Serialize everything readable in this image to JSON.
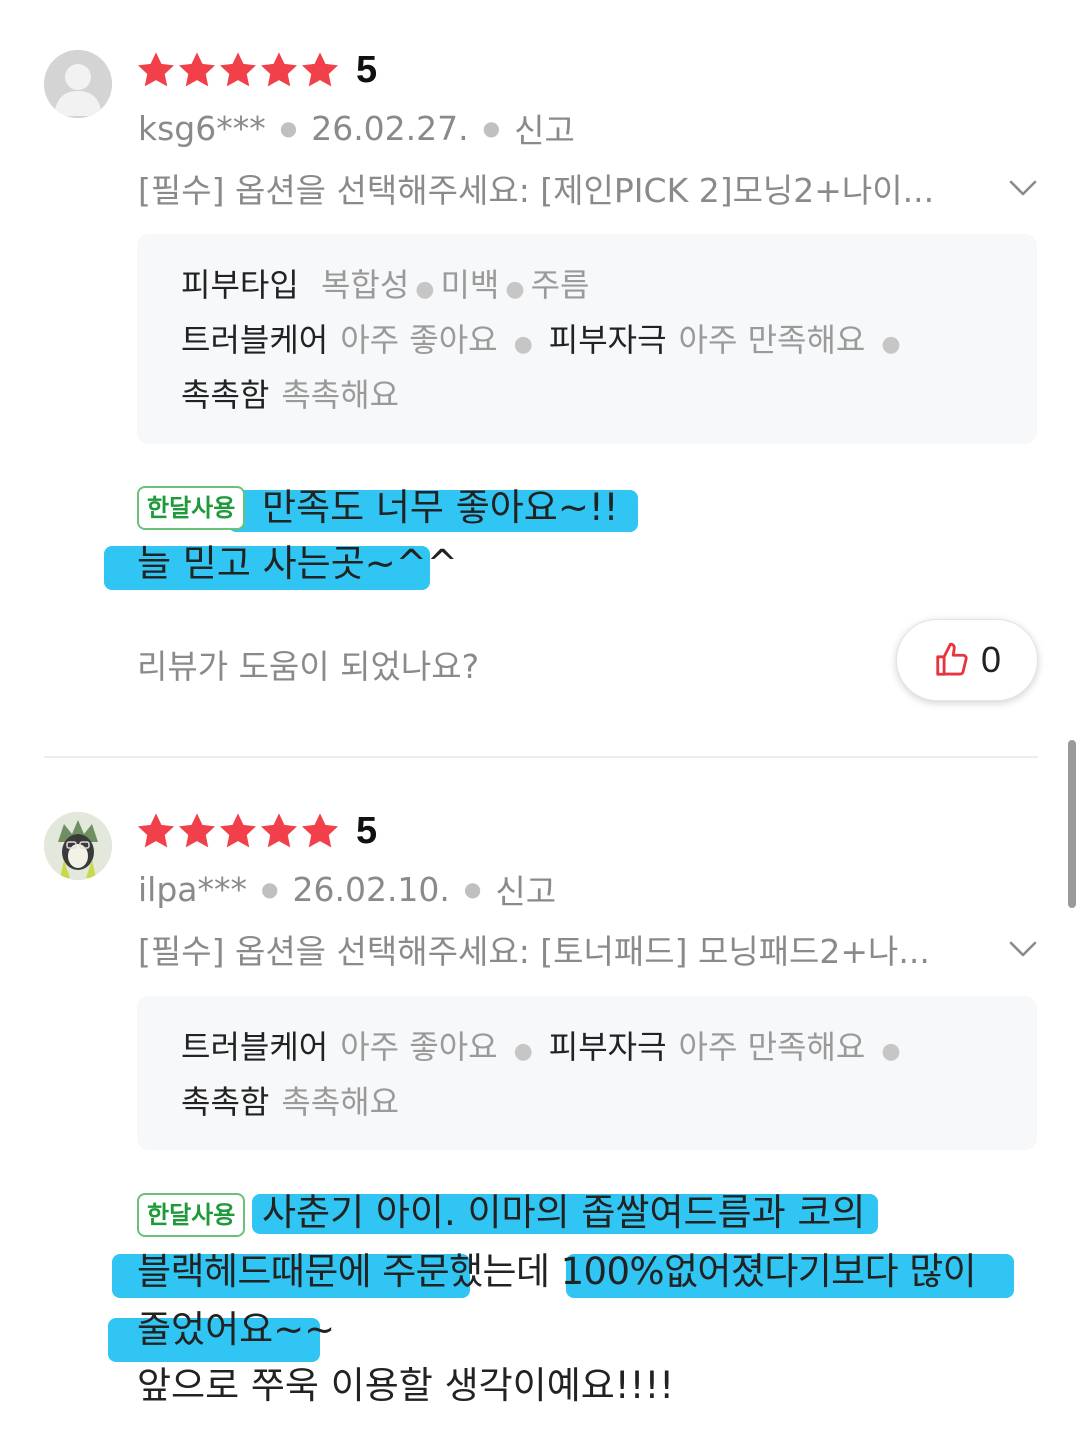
{
  "reviews": [
    {
      "rating": "5",
      "stars": 5,
      "user": "ksg6***",
      "date": "26.02.27.",
      "report": "신고",
      "option": "[필수] 옵션을 선택해주세요: [제인PICK 2]모닝2+나이...",
      "attr_line1": {
        "key": "피부타입",
        "vals": [
          "복합성",
          "미백",
          "주름"
        ]
      },
      "attr_line2": {
        "k1": "트러블케어",
        "v1": "아주 좋아요",
        "k2": "피부자극",
        "v2": "아주 만족해요"
      },
      "attr_line3": {
        "k": "촉촉함",
        "v": "촉촉해요"
      },
      "badge": "한달사용",
      "body": [
        "만족도 너무 좋아요~!!",
        "늘 믿고 사는곳~^^"
      ],
      "helpful_question": "리뷰가 도움이 되었나요?",
      "likes": "0"
    },
    {
      "rating": "5",
      "stars": 5,
      "user": "ilpa***",
      "date": "26.02.10.",
      "report": "신고",
      "option": "[필수] 옵션을 선택해주세요: [토너패드] 모닝패드2+나...",
      "attr_line1": {
        "k1": "트러블케어",
        "v1": "아주 좋아요",
        "k2": "피부자극",
        "v2": "아주 만족해요"
      },
      "attr_line2": {
        "k": "촉촉함",
        "v": "촉촉해요"
      },
      "badge": "한달사용",
      "body": [
        "사춘기 아이. 이마의 좁쌀여드름과 코의",
        "블랙헤드때문에 주문했는데 100%없어졌다기보다 많이",
        "줄었어요~~",
        "앞으로 쭈욱 이용할 생각이예요!!!!"
      ]
    }
  ],
  "colors": {
    "star": "#f2404a",
    "highlight": "#1fc0f2",
    "badge_border": "#6cc07a",
    "badge_text": "#1f9a3a",
    "like_icon": "#e8343c"
  },
  "icons": {
    "avatar1": "default-user-avatar",
    "avatar2": "character-avatar",
    "chevron": "chevron-down-icon",
    "like": "thumbs-up-icon"
  }
}
